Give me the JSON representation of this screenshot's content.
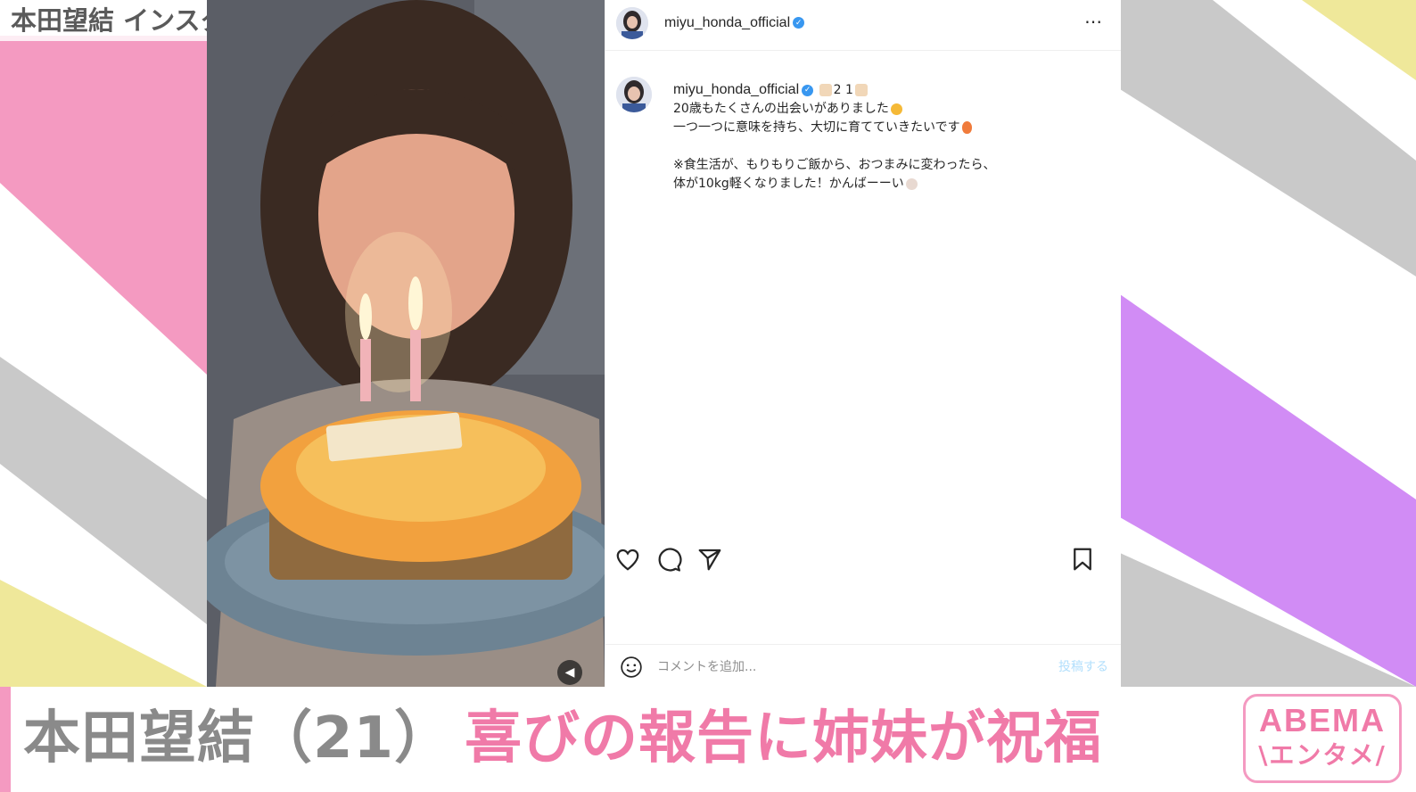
{
  "overlay": {
    "credit": "本田望結 インスタグラムより"
  },
  "post": {
    "username": "miyu_honda_official",
    "more_icon": "⋯",
    "caption": {
      "username": "miyu_honda_official",
      "title_number": "2 1",
      "lines": [
        "20歳もたくさんの出会いがありました",
        "一つ一つに意味を持ち、大切に育てていきたいです",
        "",
        "※食生活が、もりもりご飯から、おつまみに変わったら、",
        "体が10kg軽くなりました！かんばーーい"
      ]
    },
    "icons": [
      "heart-icon",
      "comment-icon",
      "share-icon",
      "bookmark-icon"
    ],
    "comment": {
      "placeholder": "コメントを追加...",
      "post_label": "投稿する"
    }
  },
  "banner": {
    "name_part": "本田望結（21）",
    "headline_part": "喜びの報告に姉妹が祝福",
    "logo_line1": "ABEMA",
    "logo_line2": "\\エンタメ/"
  },
  "colors": {
    "pink": "#f07aa8",
    "gray": "#8a8a8a",
    "purple": "#d18cf5",
    "yellow": "#efe89a"
  }
}
